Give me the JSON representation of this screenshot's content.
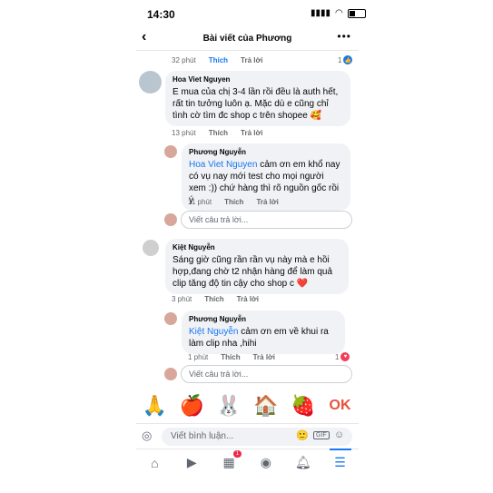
{
  "status": {
    "time": "14:30"
  },
  "header": {
    "title": "Bài viết của Phương"
  },
  "top_meta": {
    "time": "32 phút",
    "like": "Thích",
    "reply": "Trả lời",
    "count": "1"
  },
  "comments": [
    {
      "author": "Hoa Viet Nguyen",
      "text": "E mua của chị 3-4 lần rồi đều là auth hết, rất tin tưởng luôn ạ. Mặc dù e cũng chỉ tình cờ tìm đc shop c trên shopee 🥰",
      "time": "13 phút",
      "like": "Thích",
      "reply": "Trả lời",
      "replies": [
        {
          "author": "Phương Nguyễn",
          "mention": "Hoa Viet Nguyen",
          "text": " cảm ơn em khổ nay có vụ nay mới test cho mọi người xem :)) chứ hàng thì rõ nguồn gốc rồi ý",
          "time": "11 phút",
          "like": "Thích",
          "reply": "Trả lời"
        }
      ],
      "reply_placeholder": "Viết câu trả lời..."
    },
    {
      "author": "Kiệt Nguyễn",
      "text": "Sáng giờ cũng rần rần vụ này mà e hồi hợp,đang chờ t2 nhận hàng để làm quả clip tăng độ tin cậy cho shop c ❤️",
      "time": "3 phút",
      "like": "Thích",
      "reply": "Trả lời",
      "replies": [
        {
          "author": "Phương Nguyễn",
          "mention": "Kiệt Nguyễn",
          "text": " cảm ơn em về khui ra làm clip nha ,hihi",
          "time": "1 phút",
          "like": "Thích",
          "reply": "Trả lời",
          "count": "1"
        }
      ],
      "reply_placeholder": "Viết câu trả lời..."
    }
  ],
  "stickers": [
    "🙏",
    "🍎",
    "🐰",
    "🏠",
    "🍓",
    "OK"
  ],
  "composer": {
    "placeholder": "Viết bình luận...",
    "gif": "GIF"
  },
  "tabs": {
    "marketplace_badge": "1"
  }
}
